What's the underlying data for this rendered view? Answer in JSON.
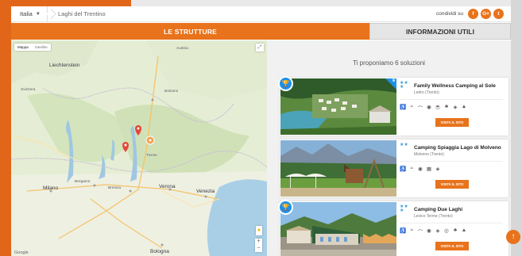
{
  "breadcrumb": {
    "country": "Italia",
    "current": "Laghi del Trentino"
  },
  "share": {
    "label": "condividi su",
    "icons": [
      "facebook-icon",
      "google-plus-icon",
      "twitter-icon"
    ],
    "glyphs": [
      "f",
      "G+",
      "t"
    ]
  },
  "tabs": {
    "structures": "LE STRUTTURE",
    "info": "INFORMAZIONI UTILI"
  },
  "map": {
    "map_type": "Mappa",
    "satellite_type": "Satellite",
    "google": "Google",
    "labels": {
      "liechtenstein": "Liechtenstein",
      "milano": "Milano",
      "verona": "Verona",
      "venezia": "Venezia",
      "bologna": "Bologna",
      "brescia": "Brescia",
      "bergamo": "Bergamo",
      "trento": "Trento",
      "bolzano": "Bolzano",
      "austria": "Austria",
      "svizzera": "Svizzera"
    }
  },
  "results": {
    "title": "Ti proponiamo 6 soluzioni",
    "cards": [
      {
        "name": "Family Wellness Camping al Sole",
        "location": "Ledro (Trento)",
        "stars": "★★\n★",
        "button": "VISITA IL SITO",
        "amenities": [
          "♿",
          "≈",
          "⌒",
          "◉",
          "☕",
          "♣",
          "◈",
          "▲"
        ]
      },
      {
        "name": "Camping Spiaggia Lago di Molveno",
        "location": "Molveno (Trento)",
        "stars": "★★",
        "button": "VISITA IL SITO",
        "amenities": [
          "♿",
          "≈",
          "◉",
          "▦",
          "◈"
        ]
      },
      {
        "name": "Camping Due Laghi",
        "location": "Levico Terme (Trento)",
        "stars": "★★\n★",
        "button": "VISITA IL SITO",
        "amenities": [
          "♿",
          "≈",
          "⌒",
          "◉",
          "◈",
          "◎",
          "♣",
          "▲"
        ]
      }
    ]
  },
  "colors": {
    "accent": "#e8731c",
    "badge": "#1e90e8",
    "star": "#3a9bd9"
  }
}
